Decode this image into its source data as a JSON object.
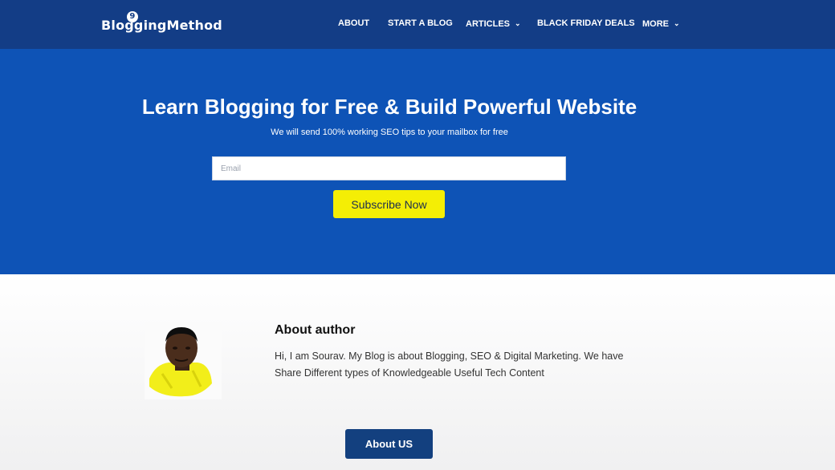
{
  "header": {
    "logo_text": "BloggingMethod",
    "logo_badge": "9",
    "nav": [
      {
        "label": "ABOUT",
        "has_dropdown": false
      },
      {
        "label": "START A BLOG",
        "has_dropdown": false
      },
      {
        "label": "ARTICLES",
        "has_dropdown": true
      },
      {
        "label": "BLACK FRIDAY DEALS",
        "has_dropdown": false
      },
      {
        "label": "MORE",
        "has_dropdown": true
      }
    ],
    "dropdown_icon": "chevron-down-icon"
  },
  "hero": {
    "title": "Learn Blogging for Free & Build Powerful Website",
    "subtitle": "We will send 100% working SEO tips to your mailbox for free",
    "email_placeholder": "Email",
    "email_value": "",
    "subscribe_label": "Subscribe Now"
  },
  "about": {
    "title": "About author",
    "text": "Hi, I am Sourav. My Blog is about Blogging, SEO & Digital Marketing. We have Share Different types of Knowledgeable Useful Tech Content",
    "button_label": "About US"
  },
  "colors": {
    "navbar": "#133d86",
    "hero": "#0e53b6",
    "subscribe_button": "#f4ee05",
    "about_button": "#13407f"
  }
}
